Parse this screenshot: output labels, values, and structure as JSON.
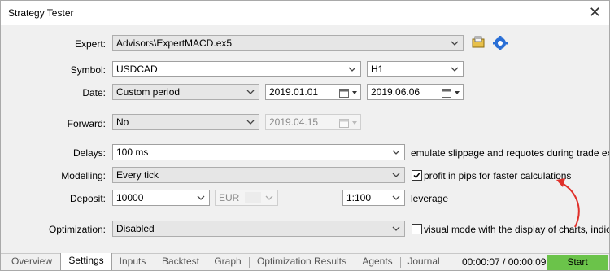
{
  "window": {
    "title": "Strategy Tester"
  },
  "expert": {
    "label": "Expert:",
    "value": "Advisors\\ExpertMACD.ex5"
  },
  "symbol": {
    "label": "Symbol:",
    "value": "USDCAD",
    "timeframe": "H1"
  },
  "date": {
    "label": "Date:",
    "mode": "Custom period",
    "from": "2019.01.01",
    "to": "2019.06.06"
  },
  "forward": {
    "label": "Forward:",
    "mode": "No",
    "date": "2019.04.15"
  },
  "delays": {
    "label": "Delays:",
    "value": "100 ms",
    "note": "emulate slippage and requotes during trade executi"
  },
  "modelling": {
    "label": "Modelling:",
    "value": "Every tick",
    "checkbox_label": "profit in pips for faster calculations",
    "checked": true
  },
  "deposit": {
    "label": "Deposit:",
    "value": "10000",
    "currency": "EUR",
    "leverage": "1:100",
    "leverage_label": "leverage"
  },
  "optimization": {
    "label": "Optimization:",
    "value": "Disabled",
    "checkbox_label": "visual mode with the display of charts, indicators"
  },
  "tabs": [
    "Overview",
    "Settings",
    "Inputs",
    "Backtest",
    "Graph",
    "Optimization Results",
    "Agents",
    "Journal"
  ],
  "active_tab": "Settings",
  "timer": "00:00:07 / 00:00:09",
  "start_label": "Start",
  "colors": {
    "accent_arrow": "#e0302a",
    "start_button": "#6bc34a",
    "settings_icon": "#2a6fd6"
  }
}
